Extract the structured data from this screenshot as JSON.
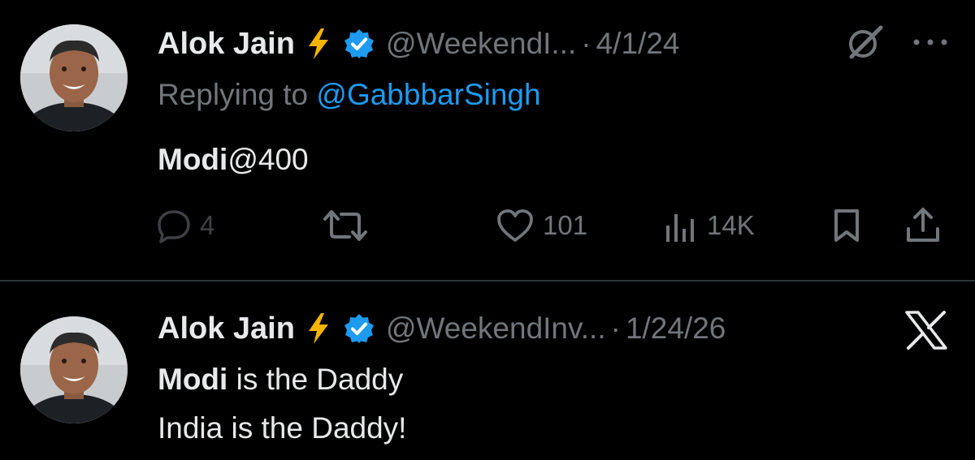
{
  "tweets": [
    {
      "author": "Alok Jain",
      "handle": "@WeekendI...",
      "separator": "·",
      "date": "4/1/24",
      "reply_prefix": "Replying to ",
      "reply_to": "@GabbbarSingh",
      "body_bold": "Modi",
      "body_rest": "@400",
      "actions": {
        "replies": "4",
        "retweets": "",
        "likes": "101",
        "views": "14K"
      }
    },
    {
      "author": "Alok Jain",
      "handle": "@WeekendInv...",
      "separator": "·",
      "date": "1/24/26",
      "line1_bold": "Modi",
      "line1_rest": " is the Daddy",
      "line2": "India is the Daddy!"
    }
  ],
  "colors": {
    "background": "#000000",
    "text": "#e7e9ea",
    "muted": "#71767b",
    "link": "#1d9bf0",
    "divider": "#2f3336",
    "verified": "#1d9bf0",
    "bolt": "#f5b400"
  },
  "icons": [
    "lightning-emoji",
    "verified-badge-icon",
    "grok-icon",
    "more-icon",
    "reply-icon",
    "retweet-icon",
    "like-icon",
    "views-icon",
    "bookmark-icon",
    "share-icon",
    "x-logo"
  ]
}
